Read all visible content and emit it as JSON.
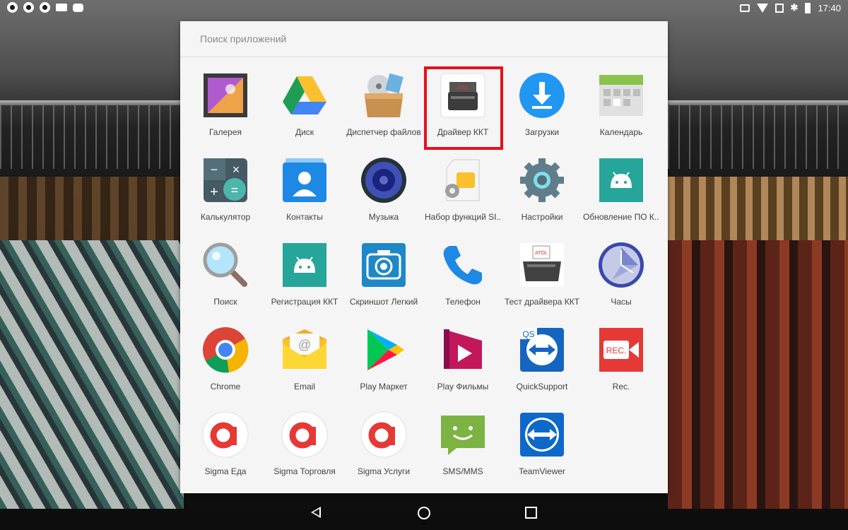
{
  "status_bar": {
    "time": "17:40",
    "bluetooth": "✱"
  },
  "drawer": {
    "search_placeholder": "Поиск приложений",
    "highlighted_app": "Драйвер ККТ",
    "apps": [
      {
        "label": "Галерея",
        "icon": "gallery-icon"
      },
      {
        "label": "Диск",
        "icon": "drive-icon"
      },
      {
        "label": "Диспетчер файлов",
        "icon": "file-manager-icon"
      },
      {
        "label": "Драйвер ККТ",
        "icon": "kkt-driver-icon"
      },
      {
        "label": "Загрузки",
        "icon": "downloads-icon"
      },
      {
        "label": "Календарь",
        "icon": "calendar-icon"
      },
      {
        "label": "Калькулятор",
        "icon": "calculator-icon"
      },
      {
        "label": "Контакты",
        "icon": "contacts-icon"
      },
      {
        "label": "Музыка",
        "icon": "music-icon"
      },
      {
        "label": "Набор функций SI...",
        "icon": "sim-toolkit-icon"
      },
      {
        "label": "Настройки",
        "icon": "settings-icon"
      },
      {
        "label": "Обновление ПО К...",
        "icon": "android-update-icon"
      },
      {
        "label": "Поиск",
        "icon": "search-icon"
      },
      {
        "label": "Регистрация ККТ",
        "icon": "android-registration-icon"
      },
      {
        "label": "Скриншот Легкий",
        "icon": "screenshot-camera-icon"
      },
      {
        "label": "Телефон",
        "icon": "phone-icon"
      },
      {
        "label": "Тест драйвера ККТ",
        "icon": "receipt-printer-icon"
      },
      {
        "label": "Часы",
        "icon": "clock-icon"
      },
      {
        "label": "Chrome",
        "icon": "chrome-icon"
      },
      {
        "label": "Email",
        "icon": "email-icon"
      },
      {
        "label": "Play Маркет",
        "icon": "play-store-icon"
      },
      {
        "label": "Play Фильмы",
        "icon": "play-movies-icon"
      },
      {
        "label": "QuickSupport",
        "icon": "quicksupport-icon"
      },
      {
        "label": "Rec.",
        "icon": "rec-icon"
      },
      {
        "label": "Sigma Еда",
        "icon": "sigma-icon"
      },
      {
        "label": "Sigma Торговля",
        "icon": "sigma-icon"
      },
      {
        "label": "Sigma Услуги",
        "icon": "sigma-icon"
      },
      {
        "label": "SMS/MMS",
        "icon": "sms-icon"
      },
      {
        "label": "TeamViewer",
        "icon": "teamviewer-icon"
      }
    ]
  },
  "colors": {
    "highlight": "#e5101c",
    "panel_bg": "#f5f5f5"
  }
}
